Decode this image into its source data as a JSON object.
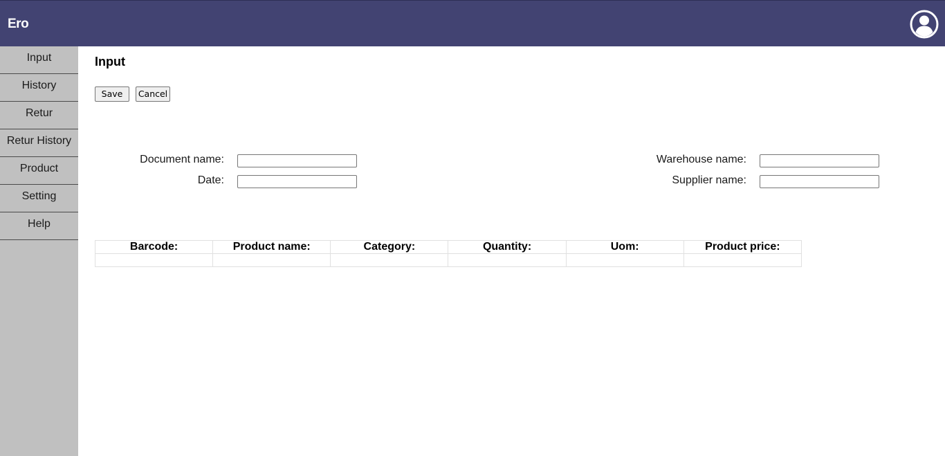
{
  "header": {
    "brand": "Ero",
    "avatar_icon": "user-circle-icon",
    "background_color": "#424372"
  },
  "sidebar": {
    "background_color": "#c0c0c0",
    "items": [
      {
        "label": "Input"
      },
      {
        "label": "History"
      },
      {
        "label": "Retur"
      },
      {
        "label": "Retur History"
      },
      {
        "label": "Product"
      },
      {
        "label": "Setting"
      },
      {
        "label": "Help"
      }
    ]
  },
  "main": {
    "title": "Input",
    "buttons": {
      "save_label": "Save",
      "cancel_label": "Cancel"
    },
    "form": {
      "document_name": {
        "label": "Document name:",
        "value": ""
      },
      "date": {
        "label": "Date:",
        "value": ""
      },
      "warehouse_name": {
        "label": "Warehouse name:",
        "value": ""
      },
      "supplier_name": {
        "label": "Supplier name:",
        "value": ""
      }
    },
    "table": {
      "headers": [
        "Barcode:",
        "Product name:",
        "Category:",
        "Quantity:",
        "Uom:",
        "Product price:"
      ],
      "rows": [
        [
          "",
          "",
          "",
          "",
          "",
          ""
        ]
      ]
    }
  }
}
